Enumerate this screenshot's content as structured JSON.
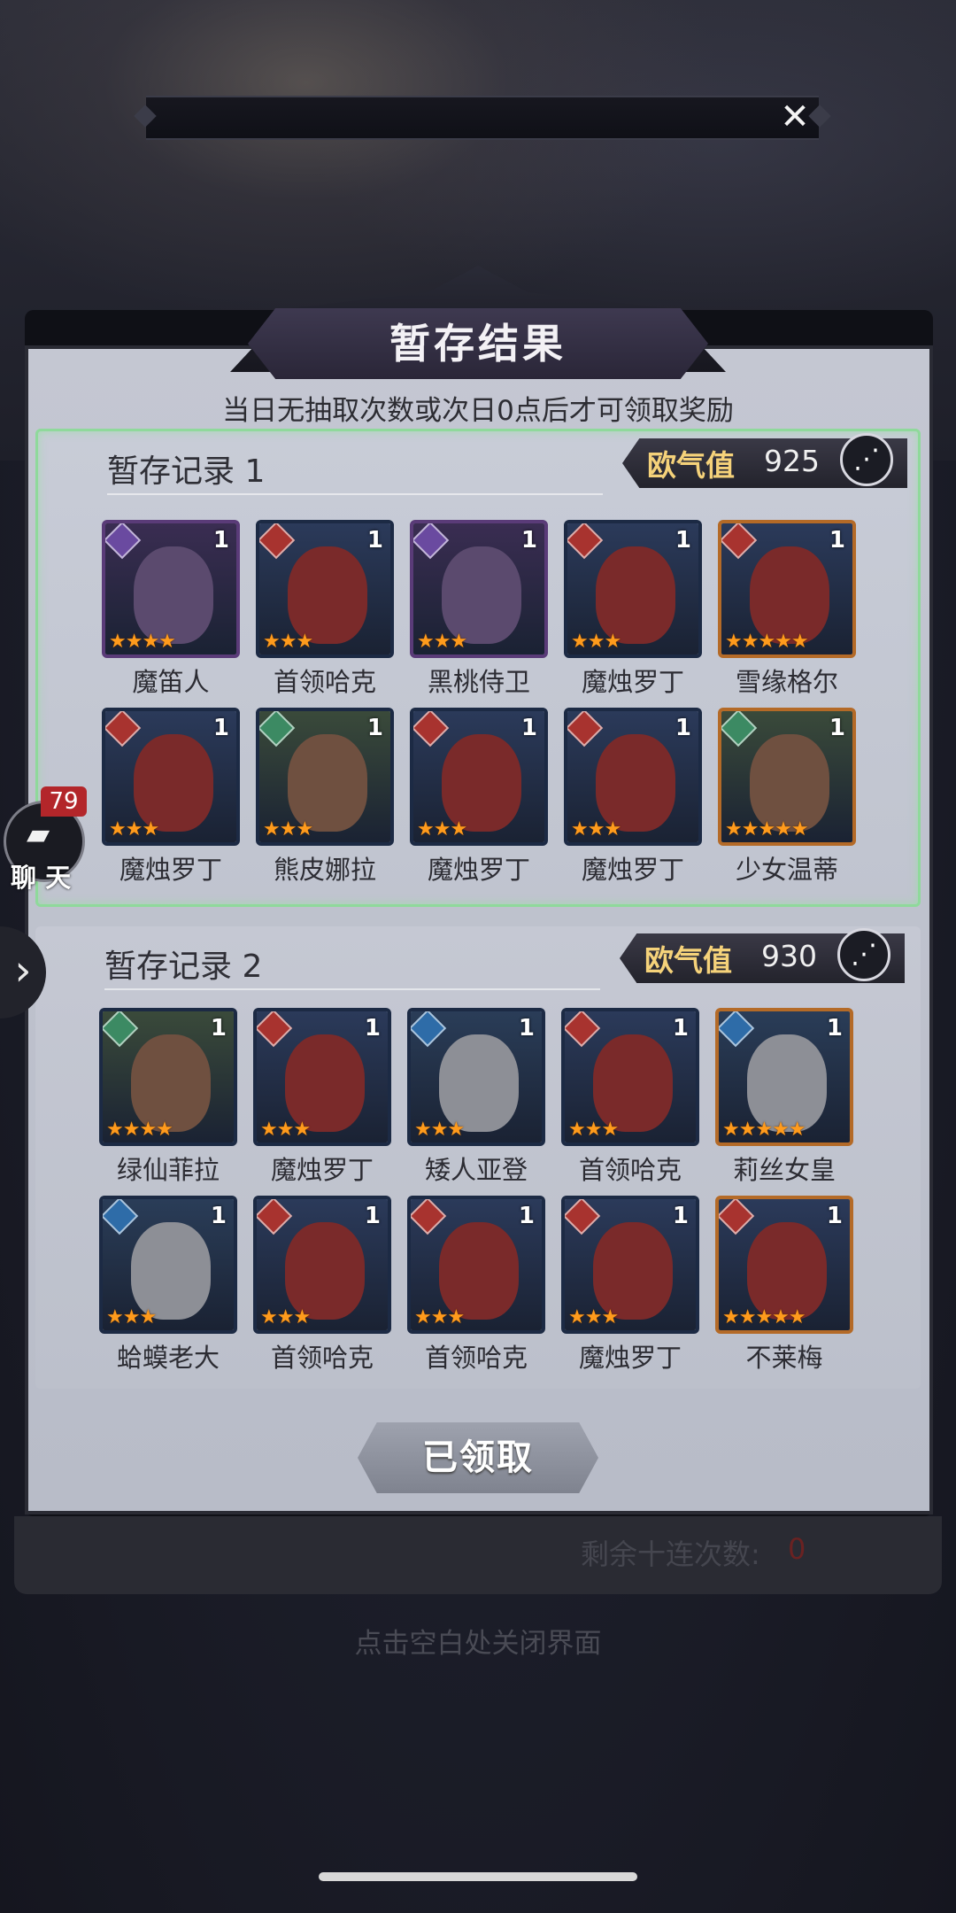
{
  "banner_bg_title": "",
  "close_icon": "close-icon",
  "panel": {
    "title": "暂存结果",
    "subtitle": "当日无抽取次数或次日0点后才可领取奖励"
  },
  "records": [
    {
      "title": "暂存记录 1",
      "luck_label": "欧气值",
      "luck_value": "925",
      "heroes": [
        {
          "name": "魔笛人",
          "element": "dark",
          "count": "1",
          "stars": 4
        },
        {
          "name": "首领哈克",
          "element": "fire",
          "count": "1",
          "stars": 3
        },
        {
          "name": "黑桃侍卫",
          "element": "dark",
          "count": "1",
          "stars": 3
        },
        {
          "name": "魔烛罗丁",
          "element": "fire",
          "count": "1",
          "stars": 3
        },
        {
          "name": "雪缘格尔",
          "element": "fire",
          "count": "1",
          "stars": 5
        },
        {
          "name": "魔烛罗丁",
          "element": "fire",
          "count": "1",
          "stars": 3
        },
        {
          "name": "熊皮娜拉",
          "element": "nature",
          "count": "1",
          "stars": 3
        },
        {
          "name": "魔烛罗丁",
          "element": "fire",
          "count": "1",
          "stars": 3
        },
        {
          "name": "魔烛罗丁",
          "element": "fire",
          "count": "1",
          "stars": 3
        },
        {
          "name": "少女温蒂",
          "element": "nature",
          "count": "1",
          "stars": 5
        }
      ]
    },
    {
      "title": "暂存记录 2",
      "luck_label": "欧气值",
      "luck_value": "930",
      "heroes": [
        {
          "name": "绿仙菲拉",
          "element": "nature",
          "count": "1",
          "stars": 4
        },
        {
          "name": "魔烛罗丁",
          "element": "fire",
          "count": "1",
          "stars": 3
        },
        {
          "name": "矮人亚登",
          "element": "water",
          "count": "1",
          "stars": 3
        },
        {
          "name": "首领哈克",
          "element": "fire",
          "count": "1",
          "stars": 3
        },
        {
          "name": "莉丝女皇",
          "element": "water",
          "count": "1",
          "stars": 5
        },
        {
          "name": "蛤蟆老大",
          "element": "water",
          "count": "1",
          "stars": 3
        },
        {
          "name": "首领哈克",
          "element": "fire",
          "count": "1",
          "stars": 3
        },
        {
          "name": "首领哈克",
          "element": "fire",
          "count": "1",
          "stars": 3
        },
        {
          "name": "魔烛罗丁",
          "element": "fire",
          "count": "1",
          "stars": 3
        },
        {
          "name": "不莱梅",
          "element": "fire",
          "count": "1",
          "stars": 5
        }
      ]
    }
  ],
  "claim_button": "已领取",
  "remaining_label": "剩余十连次数:",
  "remaining_value": "0",
  "close_hint": "点击空白处关闭界面",
  "chat": {
    "label": "聊 天",
    "badge": "79"
  },
  "side_arrow": "›",
  "colors": {
    "fire": "#a8332f",
    "dark": "#6a4aa0",
    "nature": "#3c8a63",
    "water": "#2e6ca8",
    "luck_gold": "#f5d27a",
    "star": "#ff9b1c"
  }
}
